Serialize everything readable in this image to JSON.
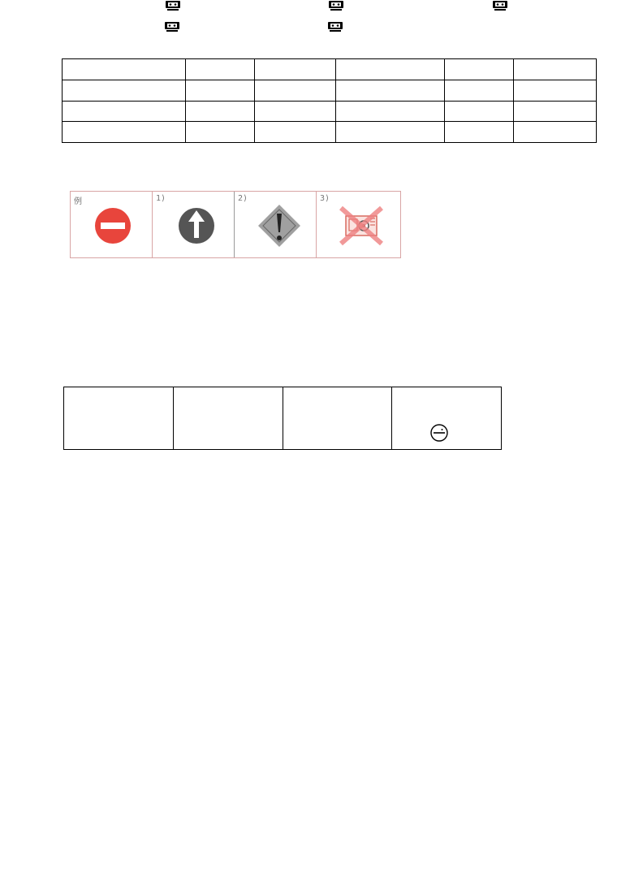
{
  "tape_icons": [
    {
      "icon": "cassette-icon"
    },
    {
      "icon": "cassette-icon"
    },
    {
      "icon": "cassette-icon"
    },
    {
      "icon": "cassette-icon"
    },
    {
      "icon": "cassette-icon"
    }
  ],
  "signs": {
    "labels": [
      "例",
      "1)",
      "2)",
      "3)"
    ],
    "icons": [
      "no-entry-sign-icon",
      "straight-ahead-sign-icon",
      "warning-diamond-sign-icon",
      "no-camera-sign-icon"
    ],
    "colors": {
      "red": "#e8453c",
      "dark": "#555555",
      "grey_diamond": "#a0a0a0",
      "border": "#d9a5a5"
    }
  },
  "answer_table": {
    "rows": 4,
    "cols": 6
  },
  "bottom_table": {
    "cols": 4,
    "example_icon": "no-entry-circle-icon"
  }
}
